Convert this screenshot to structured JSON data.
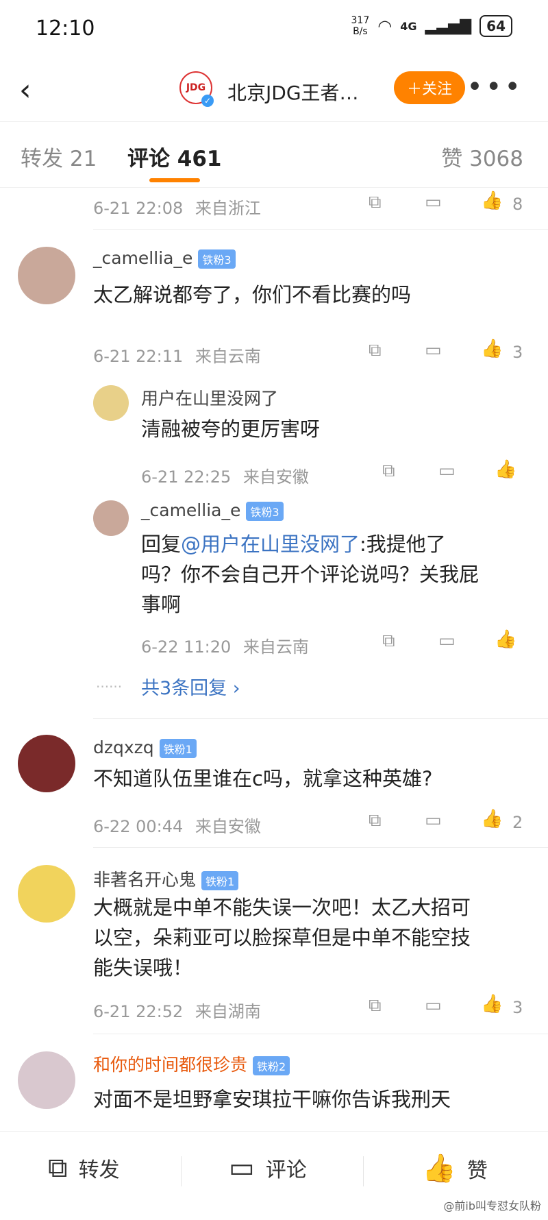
{
  "status": {
    "time": "12:10",
    "speed_top": "317",
    "speed_bottom": "B/s",
    "network": "4G",
    "battery": "64"
  },
  "nav": {
    "back": "‹",
    "title": "北京JDG王者…",
    "follow": "＋关注",
    "more": "•••",
    "avatar_text": "JDG"
  },
  "tabs": {
    "repost": "转发 21",
    "comments": "评论 461",
    "likes": "赞 3068"
  },
  "top_meta": {
    "time": "6-21 22:08",
    "loc": "来自浙江",
    "likes": "8"
  },
  "c1": {
    "user": "_camellia_e",
    "badge": "铁粉3",
    "text": "太乙解说都夸了，你们不看比赛的吗",
    "time": "6-21 22:11",
    "loc": "来自云南",
    "likes": "3"
  },
  "r1": {
    "user": "用户在山里没网了",
    "text": "清融被夸的更厉害呀",
    "time": "6-21 22:25",
    "loc": "来自安徽"
  },
  "r2": {
    "user": "_camellia_e",
    "badge": "铁粉3",
    "prefix": "回复",
    "mention": "@用户在山里没网了",
    "text_line1_tail": ":我提他了",
    "text_line2": "吗？你不会自己开个评论说吗？关我屁",
    "text_line3": "事啊",
    "time": "6-22 11:20",
    "loc": "来自云南"
  },
  "more_replies": "共3条回复 ›",
  "c2": {
    "user": "dzqxzq",
    "badge": "铁粉1",
    "text": "不知道队伍里谁在c吗，就拿这种英雄?",
    "time": "6-22 00:44",
    "loc": "来自安徽",
    "likes": "2"
  },
  "c3": {
    "user": "非著名开心鬼",
    "badge": "铁粉1",
    "line1": "大概就是中单不能失误一次吧！太乙大招可",
    "line2": "以空，朵莉亚可以脸探草但是中单不能空技",
    "line3": "能失误哦！",
    "time": "6-21 22:52",
    "loc": "来自湖南",
    "likes": "3"
  },
  "c4": {
    "user": "和你的时间都很珍贵",
    "badge": "铁粉2",
    "text": "对面不是坦野拿安琪拉干嘛你告诉我刑天"
  },
  "bottom": {
    "repost": "转发",
    "comment": "评论",
    "like": "赞"
  },
  "watermark": "@前ib叫专怼女队粉",
  "colors": {
    "accent": "#ff8200",
    "link": "#3b73c2",
    "badge": "#6aa8f5"
  }
}
